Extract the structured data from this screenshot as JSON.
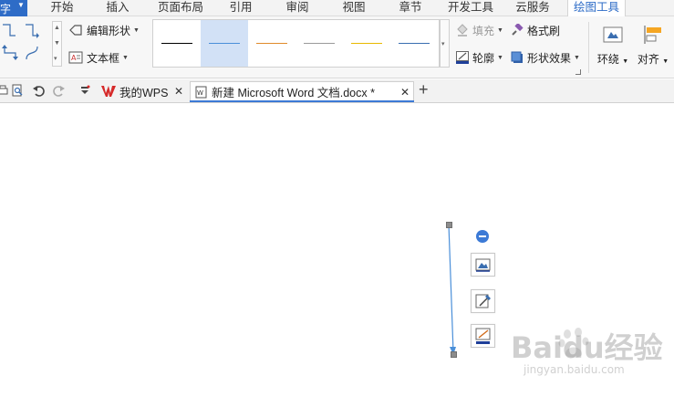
{
  "menubar": {
    "file_label": "字",
    "items": [
      {
        "label": "开始"
      },
      {
        "label": "插入"
      },
      {
        "label": "页面布局"
      },
      {
        "label": "引用"
      },
      {
        "label": "审阅"
      },
      {
        "label": "视图"
      },
      {
        "label": "章节"
      },
      {
        "label": "开发工具"
      },
      {
        "label": "云服务"
      },
      {
        "label": "绘图工具",
        "active": true
      }
    ]
  },
  "ribbon": {
    "edit_shape_label": "编辑形状",
    "text_box_label": "文本框",
    "fill_label": "填充",
    "format_painter_label": "格式刷",
    "outline_label": "轮廓",
    "shape_effects_label": "形状效果",
    "wrap_label": "环绕",
    "align_label": "对齐",
    "line_styles": [
      {
        "color": "#000000"
      },
      {
        "color": "#4a8fd9",
        "selected": true
      },
      {
        "color": "#e08a2a"
      },
      {
        "color": "#9a9a9a"
      },
      {
        "color": "#e8b800"
      },
      {
        "color": "#3a6eb0"
      }
    ]
  },
  "tabbar": {
    "tabs": [
      {
        "label": "我的WPS"
      },
      {
        "label": "新建 Microsoft Word 文档.docx *",
        "active": true
      }
    ],
    "new_tab_label": "+"
  },
  "colors": {
    "accent": "#2e6cc7",
    "line_shape": "#4a8fd9",
    "wps_red": "#d62a2a"
  },
  "watermark": {
    "brand": "Baidu经验",
    "url": "jingyan.baidu.com"
  }
}
